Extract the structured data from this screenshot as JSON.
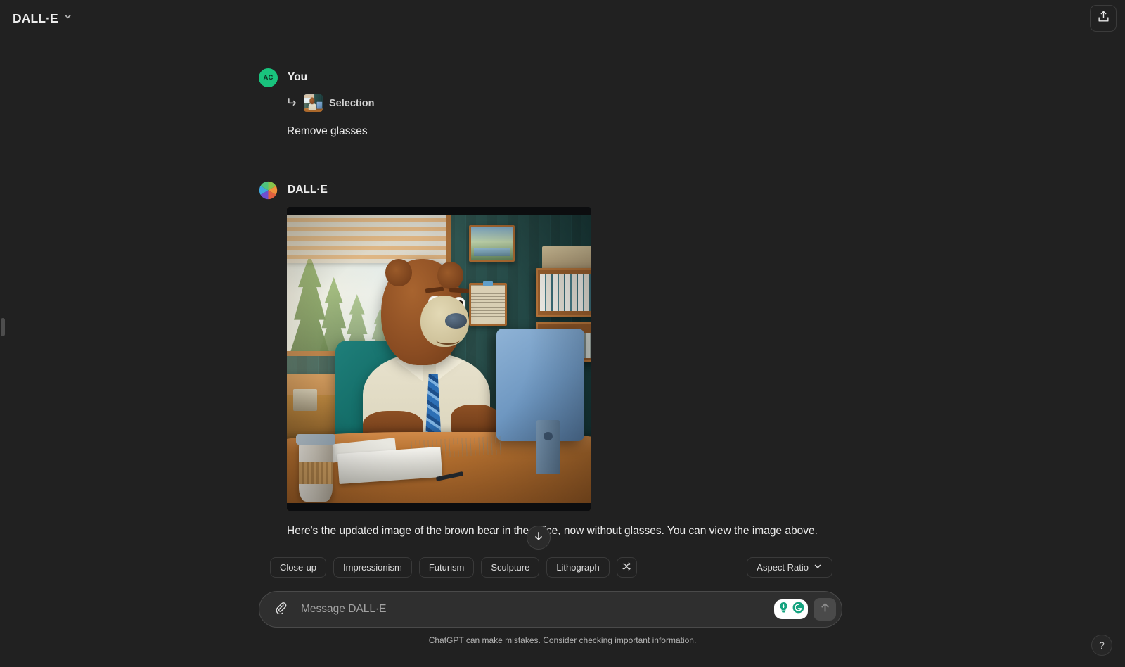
{
  "topbar": {
    "model_name": "DALL·E",
    "model_chevron_icon": "chevron-down-icon",
    "share_icon": "share-upload-icon"
  },
  "sidebar": {
    "toggle_handle_icon": "sidebar-toggle-handle"
  },
  "conversation": [
    {
      "role": "user",
      "sender": "You",
      "avatar_initials": "AC",
      "avatar_color": "#19c37d",
      "attachment": {
        "arrow_icon": "reply-arrow-icon",
        "thumbnail_icon": "image-thumbnail",
        "label": "Selection"
      },
      "text": "Remove glasses"
    },
    {
      "role": "assistant",
      "sender": "DALL·E",
      "avatar_icon": "dalle-color-wheel-icon",
      "image_alt": "Generated image of a brown bear working at an office desk",
      "text": "Here's the updated image of the brown bear in the office, now without glasses. You can view the image above."
    }
  ],
  "scroll_down_button": {
    "icon": "arrow-down-icon"
  },
  "suggestion_chips": [
    {
      "label": "Close-up",
      "icon": null
    },
    {
      "label": "Impressionism",
      "icon": null
    },
    {
      "label": "Futurism",
      "icon": null
    },
    {
      "label": "Sculpture",
      "icon": null
    },
    {
      "label": "Lithograph",
      "icon": null
    },
    {
      "label": "",
      "icon": "shuffle-icon"
    }
  ],
  "aspect_ratio_chip": {
    "label": "Aspect Ratio",
    "icon": "chevron-down-icon"
  },
  "composer": {
    "attach_icon": "paperclip-icon",
    "placeholder": "Message DALL·E",
    "value": "",
    "grammarly": {
      "bulb_icon": "lightbulb-icon",
      "logo_icon": "grammarly-g-icon",
      "color": "#15a37f"
    },
    "send_icon": "arrow-up-icon"
  },
  "footer": {
    "disclaimer": "ChatGPT can make mistakes. Consider checking important information."
  },
  "help_button": {
    "label": "?"
  },
  "colors": {
    "background": "#212121",
    "composer_bg": "#2f2f2f",
    "accent_green": "#19c37d",
    "text_primary": "#ececec",
    "text_muted": "#b4b4b4"
  }
}
